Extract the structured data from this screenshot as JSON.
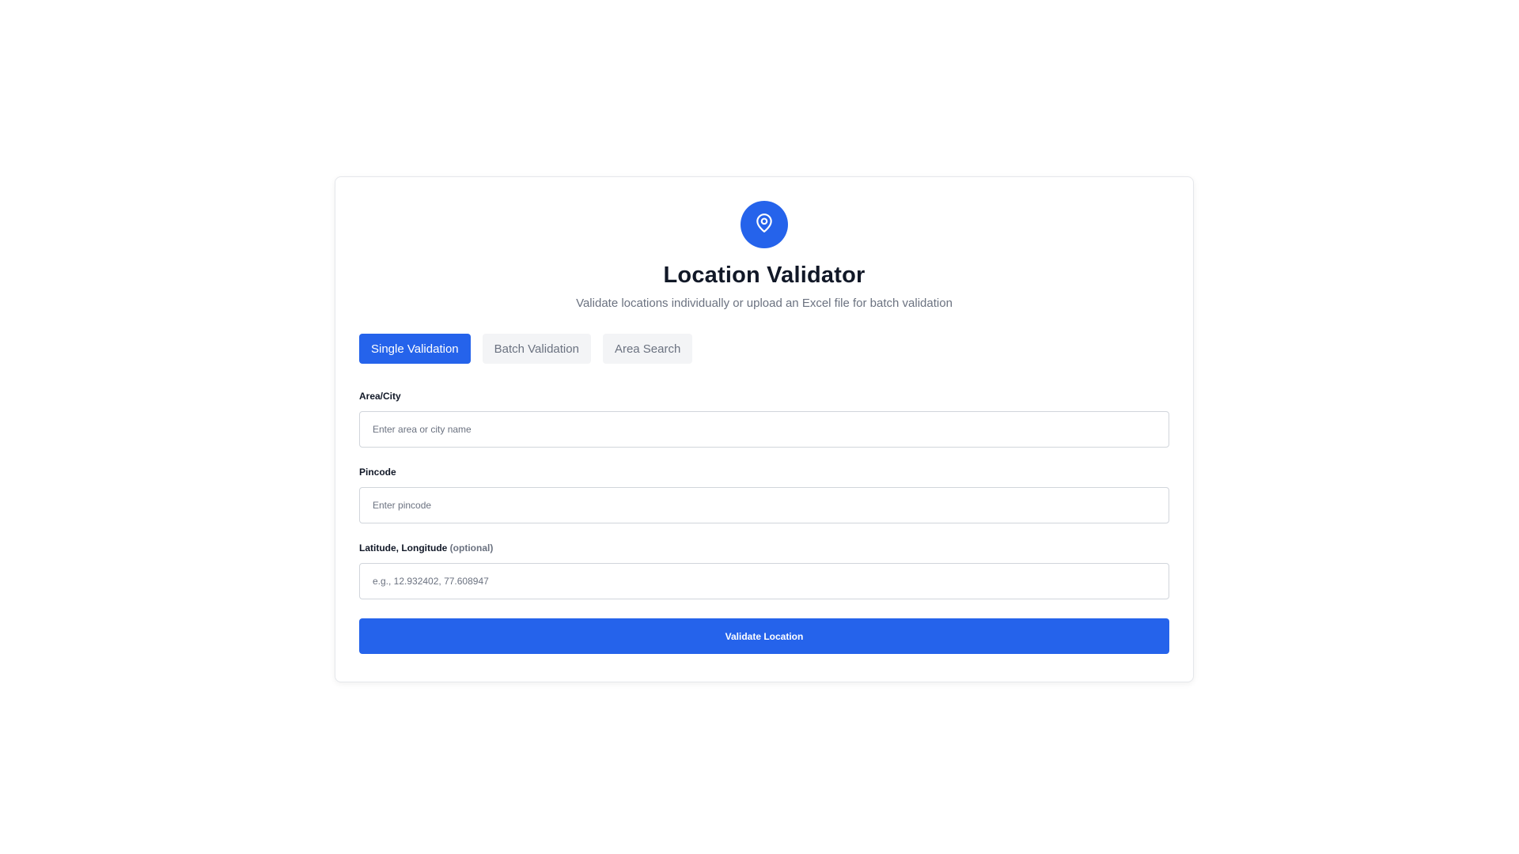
{
  "header": {
    "icon": "map-pin-icon",
    "title": "Location Validator",
    "subtitle": "Validate locations individually or upload an Excel file for batch validation"
  },
  "tabs": [
    {
      "label": "Single Validation",
      "active": true
    },
    {
      "label": "Batch Validation",
      "active": false
    },
    {
      "label": "Area Search",
      "active": false
    }
  ],
  "form": {
    "area": {
      "label": "Area/City",
      "placeholder": "Enter area or city name",
      "value": ""
    },
    "pincode": {
      "label": "Pincode",
      "placeholder": "Enter pincode",
      "value": ""
    },
    "latlng": {
      "label": "Latitude, Longitude",
      "optional_note": "(optional)",
      "placeholder": "e.g., 12.932402, 77.608947",
      "value": ""
    },
    "submit_label": "Validate Location"
  },
  "colors": {
    "accent": "#2563eb",
    "muted_text": "#6b7280",
    "tab_inactive_bg": "#f3f4f6"
  }
}
